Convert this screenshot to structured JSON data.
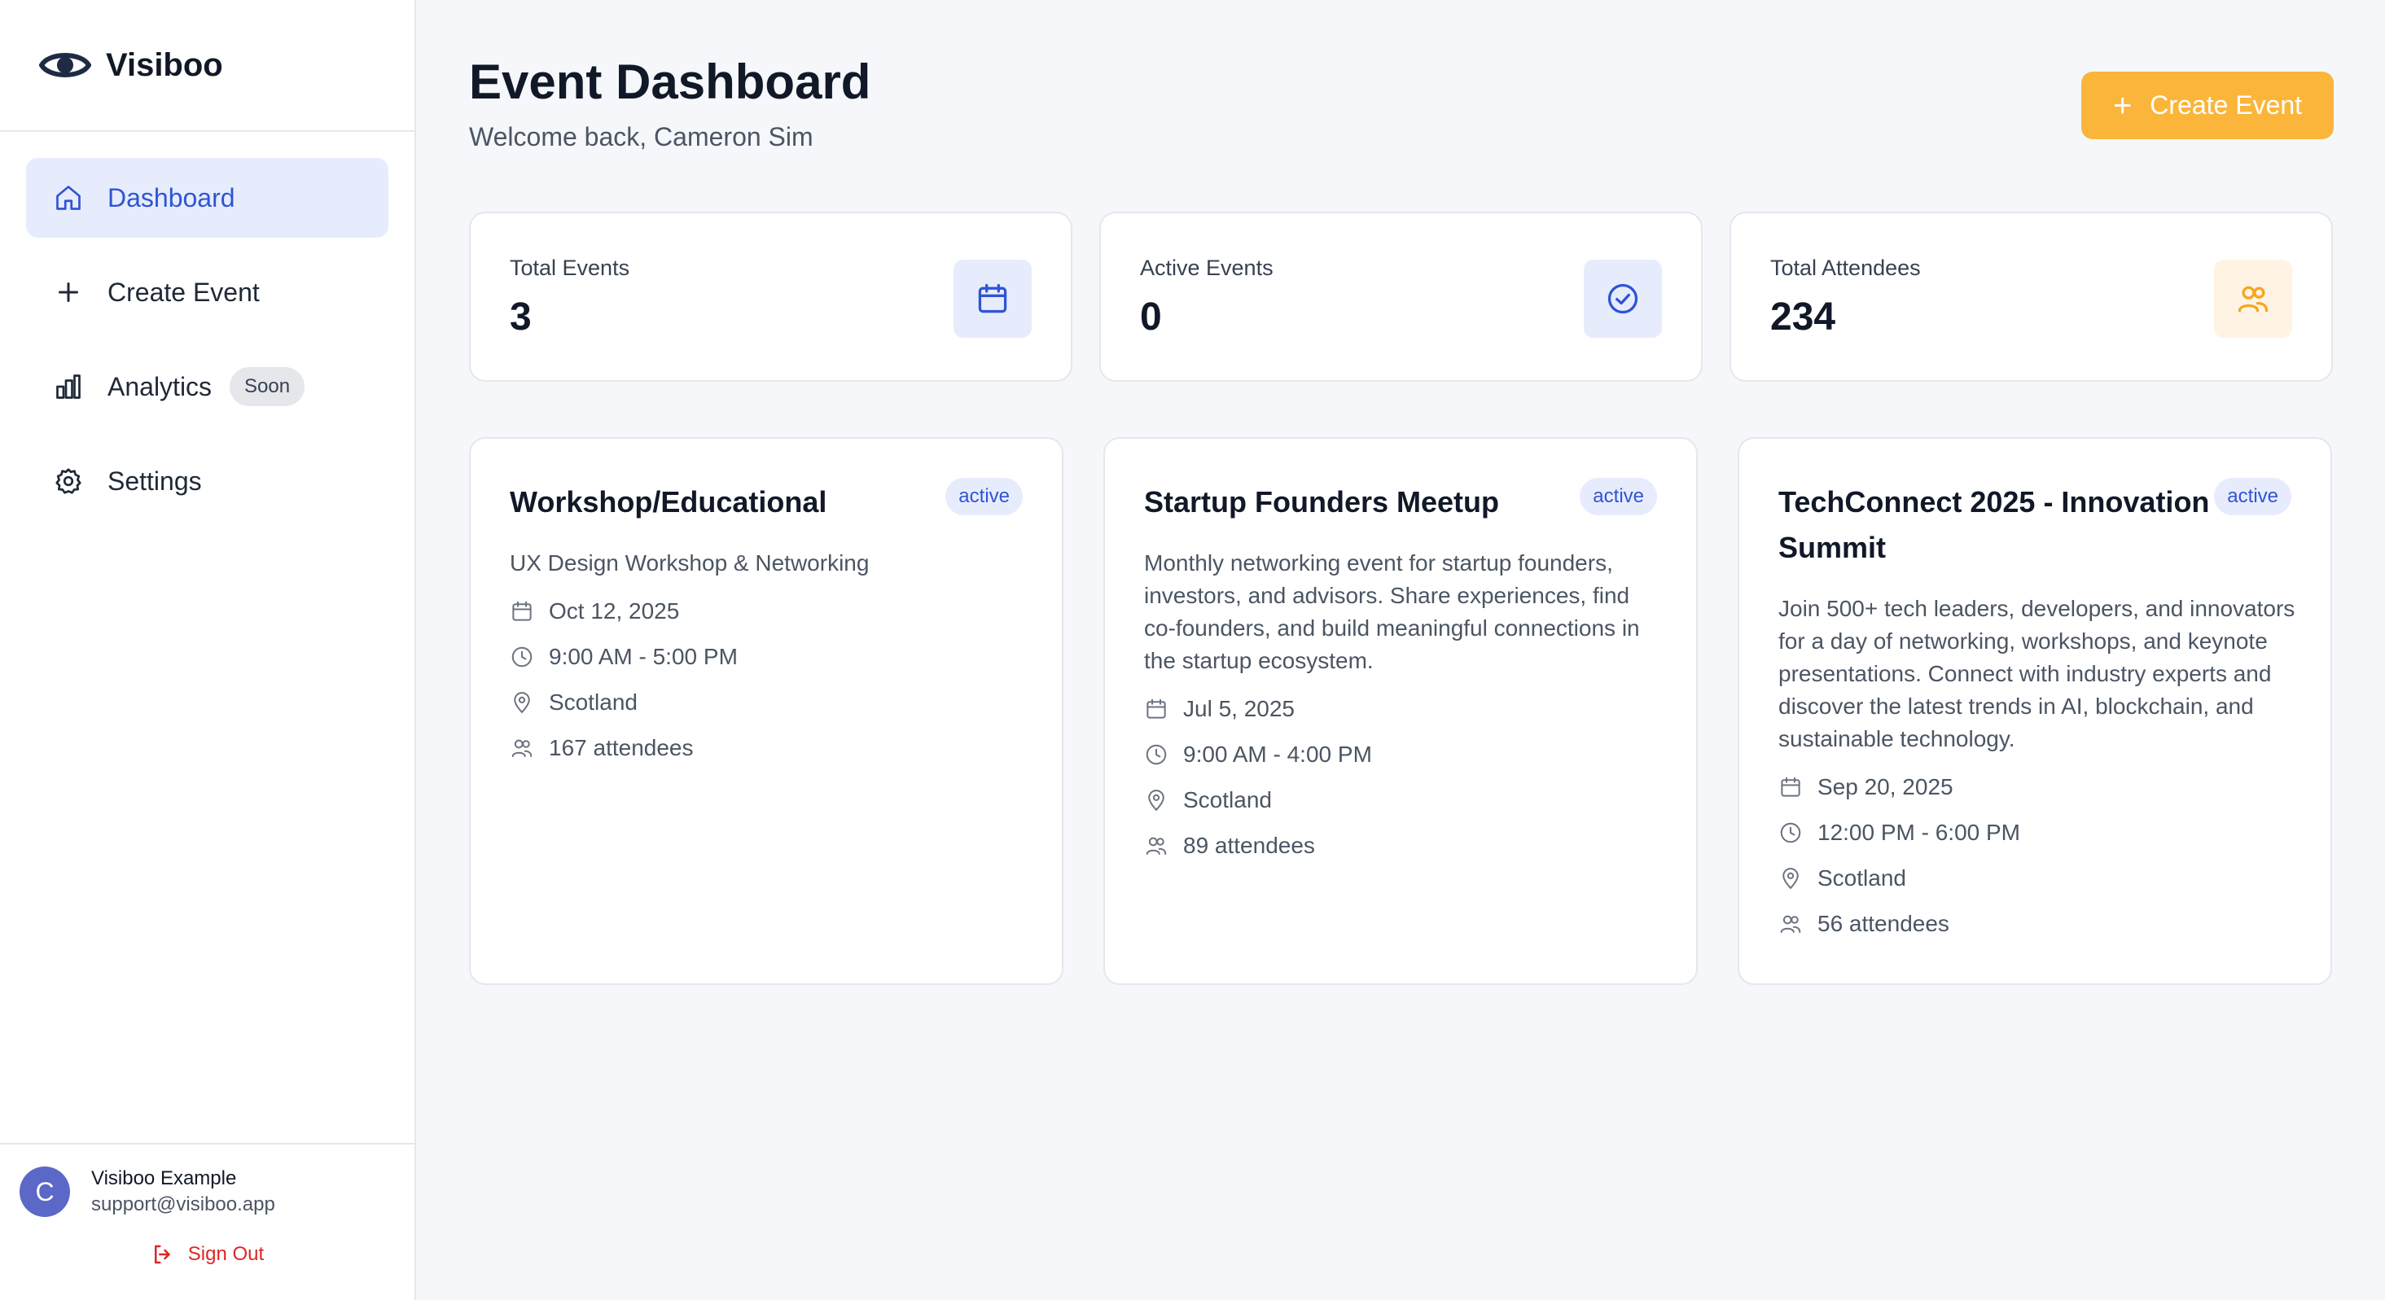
{
  "brand": {
    "name": "Visiboo"
  },
  "sidebar": {
    "items": [
      {
        "label": "Dashboard",
        "icon": "home-icon",
        "active": true
      },
      {
        "label": "Create Event",
        "icon": "plus-icon"
      },
      {
        "label": "Analytics",
        "icon": "bar-chart-icon",
        "badge": "Soon"
      },
      {
        "label": "Settings",
        "icon": "gear-icon"
      }
    ],
    "user": {
      "initial": "C",
      "name": "Visiboo Example",
      "email": "support@visiboo.app",
      "signout_label": "Sign Out"
    }
  },
  "header": {
    "title": "Event Dashboard",
    "subtitle": "Welcome back, Cameron Sim",
    "create_button_label": "Create Event"
  },
  "stats": [
    {
      "label": "Total Events",
      "value": "3",
      "icon": "calendar-icon"
    },
    {
      "label": "Active Events",
      "value": "0",
      "icon": "check-circle-icon"
    },
    {
      "label": "Total Attendees",
      "value": "234",
      "icon": "users-icon"
    }
  ],
  "events": [
    {
      "title": "Workshop/Educational",
      "status": "active",
      "description": "UX Design Workshop & Networking",
      "date": "Oct 12, 2025",
      "time": "9:00 AM - 5:00 PM",
      "location": "Scotland",
      "attendees": "167 attendees"
    },
    {
      "title": "Startup Founders Meetup",
      "status": "active",
      "description": "Monthly networking event for startup founders, investors, and advisors. Share experiences, find co-founders, and build meaningful connections in the startup ecosystem.",
      "date": "Jul 5, 2025",
      "time": "9:00 AM - 4:00 PM",
      "location": "Scotland",
      "attendees": "89 attendees"
    },
    {
      "title": "TechConnect 2025 - Innovation Summit",
      "status": "active",
      "description": "Join 500+ tech leaders, developers, and innovators for a day of networking, workshops, and keynote presentations. Connect with industry experts and discover the latest trends in AI, blockchain, and sustainable technology.",
      "date": "Sep 20, 2025",
      "time": "12:00 PM - 6:00 PM",
      "location": "Scotland",
      "attendees": "56 attendees"
    }
  ],
  "colors": {
    "accent": "#2f55d4",
    "accent_bg": "#e7ecfd",
    "create_button": "#fbb53a",
    "attendees_icon": "#f5a623",
    "attendees_icon_bg": "#fff4e3",
    "signout": "#dc2626",
    "avatar": "#5c68c7"
  }
}
